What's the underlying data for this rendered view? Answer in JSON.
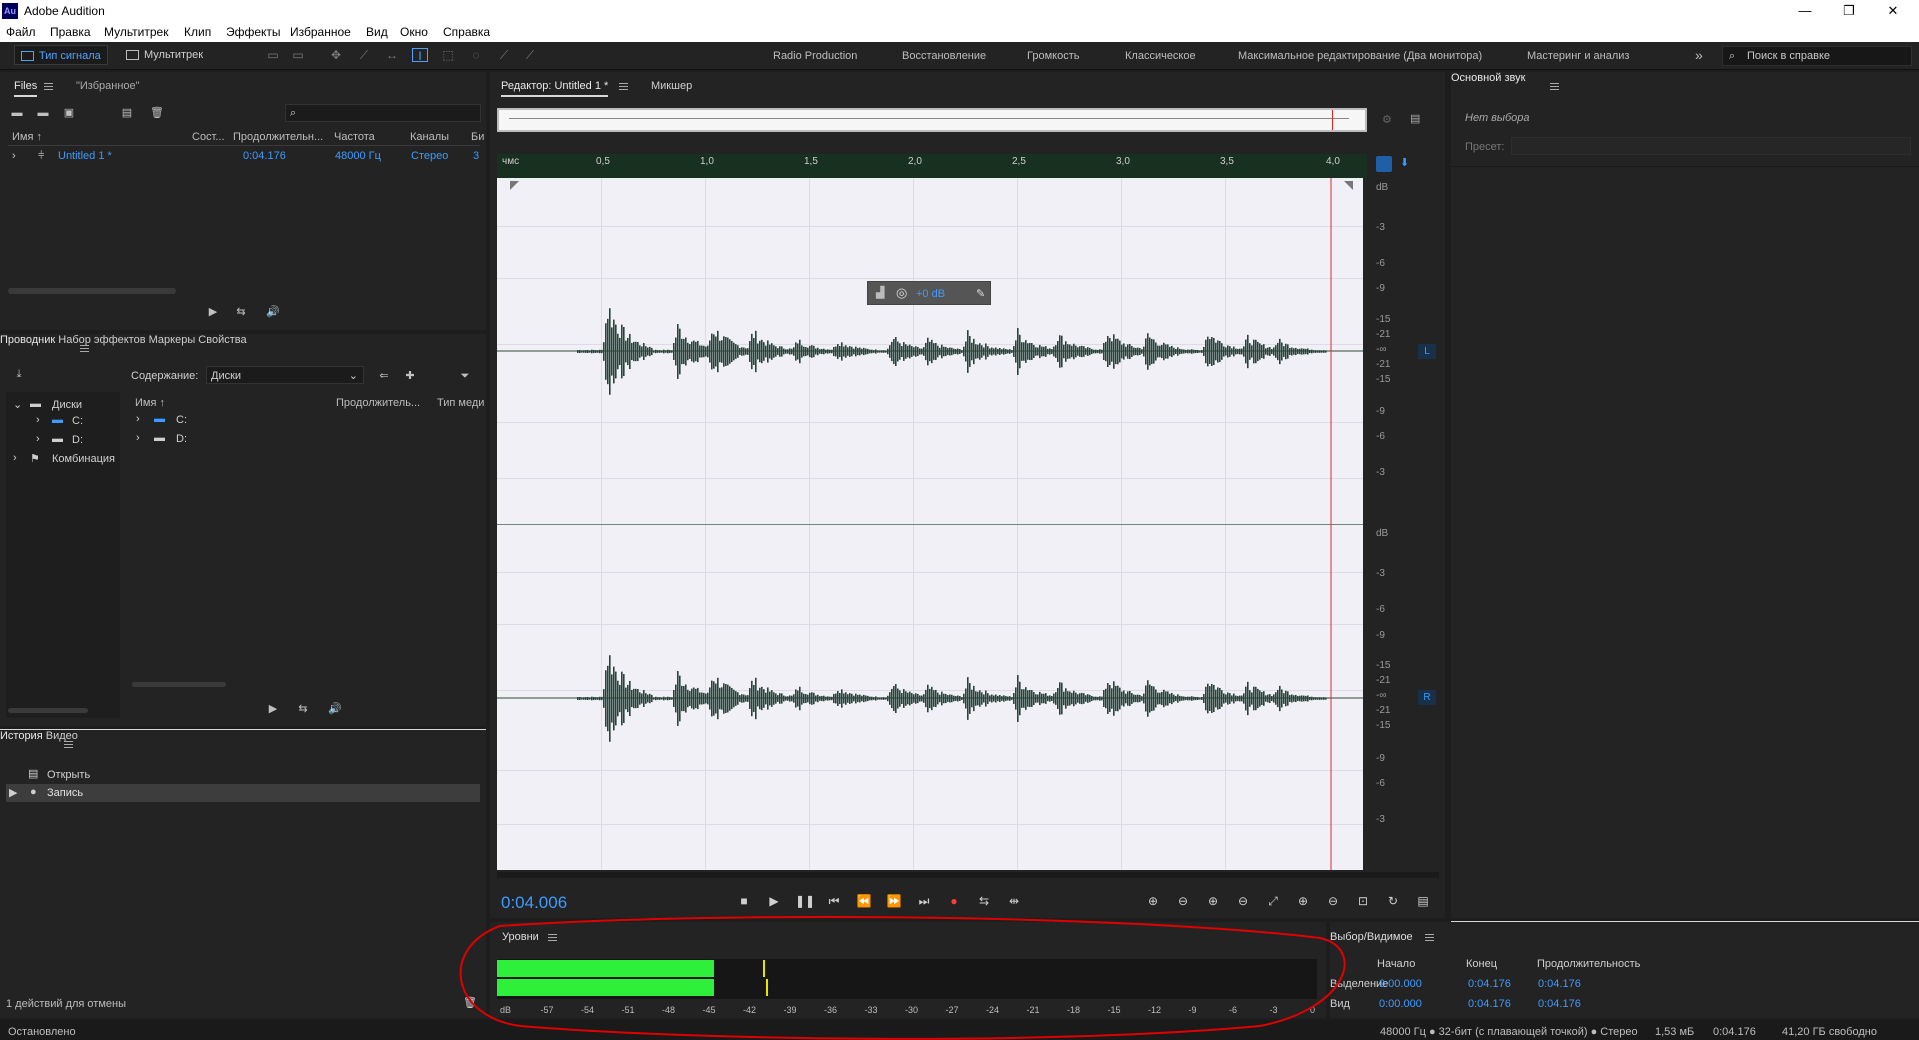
{
  "window": {
    "app_icon": "Au",
    "title": "Adobe Audition",
    "min": "—",
    "max": "❐",
    "close": "✕"
  },
  "menu": [
    "Файл",
    "Правка",
    "Мультитрек",
    "Клип",
    "Эффекты",
    "Избранное",
    "Вид",
    "Окно",
    "Справка"
  ],
  "toolbar": {
    "mode_waveform": "Тип сигнала",
    "mode_multitrack": "Мультитрек",
    "workspaces": [
      "Radio Production",
      "Восстановление",
      "Громкость",
      "Классическое",
      "Максимальное редактирование (Два монитора)",
      "Мастеринг и анализ"
    ],
    "more": "»",
    "search_placeholder": "Поиск в справке"
  },
  "files_panel": {
    "tab_files": "Files",
    "tab_favorites": "\"Избранное\"",
    "search_placeholder": "",
    "columns": [
      "Имя ↑",
      "Сост...",
      "Продолжительн...",
      "Частота",
      "Каналы",
      "Би"
    ],
    "rows": [
      {
        "name": "Untitled 1 *",
        "duration": "0:04.176",
        "rate": "48000 Гц",
        "channels": "Стерео",
        "bits": "3"
      }
    ]
  },
  "explorer_panel": {
    "tabs": [
      "Проводник",
      "Набор эффектов",
      "Маркеры",
      "Свойства"
    ],
    "content_label": "Содержание:",
    "content_value": "Диски",
    "tree": [
      "Диски",
      "C:",
      "D:",
      "Комбинация"
    ],
    "columns": [
      "Имя ↑",
      "Продолжитель...",
      "Тип меди"
    ],
    "items": [
      "C:",
      "D:"
    ]
  },
  "history_panel": {
    "tabs": [
      "История",
      "Видео"
    ],
    "items": [
      "Открыть",
      "Запись"
    ],
    "undo_text": "1 действий для отмены"
  },
  "editor": {
    "tab_editor": "Редактор: Untitled 1 *",
    "tab_mixer": "Микшер",
    "ruler": [
      "чмс",
      "0,5",
      "1,0",
      "1,5",
      "2,0",
      "2,5",
      "3,0",
      "3,5",
      "4,0"
    ],
    "db_scale": [
      "dB",
      "-3",
      "-6",
      "-9",
      "-15",
      "-21",
      "-∞",
      "-21",
      "-15",
      "-9",
      "-6",
      "-3"
    ],
    "channel_left": "L",
    "channel_right": "R",
    "hud_gain": "+0 dB",
    "time": "0:04.006"
  },
  "essential_sound": {
    "title": "Основной звук",
    "no_selection": "Нет выбора",
    "preset_label": "Пресет:"
  },
  "levels": {
    "title": "Уровни",
    "scale": [
      "dB",
      "-57",
      "-54",
      "-51",
      "-48",
      "-45",
      "-42",
      "-39",
      "-36",
      "-33",
      "-30",
      "-27",
      "-24",
      "-21",
      "-18",
      "-15",
      "-12",
      "-9",
      "-6",
      "-3",
      "0"
    ],
    "meter_color": "#2ef03a",
    "peak_color": "#e6e600"
  },
  "selection_view": {
    "title": "Выбор/Видимое",
    "col_start": "Начало",
    "col_end": "Конец",
    "col_duration": "Продолжительность",
    "row_selection": "Выделение",
    "row_view": "Вид",
    "sel_start": "0:00.000",
    "sel_end": "0:04.176",
    "sel_dur": "0:04.176",
    "view_start": "0:00.000",
    "view_end": "0:04.176",
    "view_dur": "0:04.176"
  },
  "status": {
    "left": "Остановлено",
    "format": "48000 Гц ● 32-бит (с плавающей точкой) ● Стерео",
    "size": "1,53 мБ",
    "duration": "0:04.176",
    "free": "41,20 ГБ свободно"
  },
  "annotation_color": "#e00000"
}
